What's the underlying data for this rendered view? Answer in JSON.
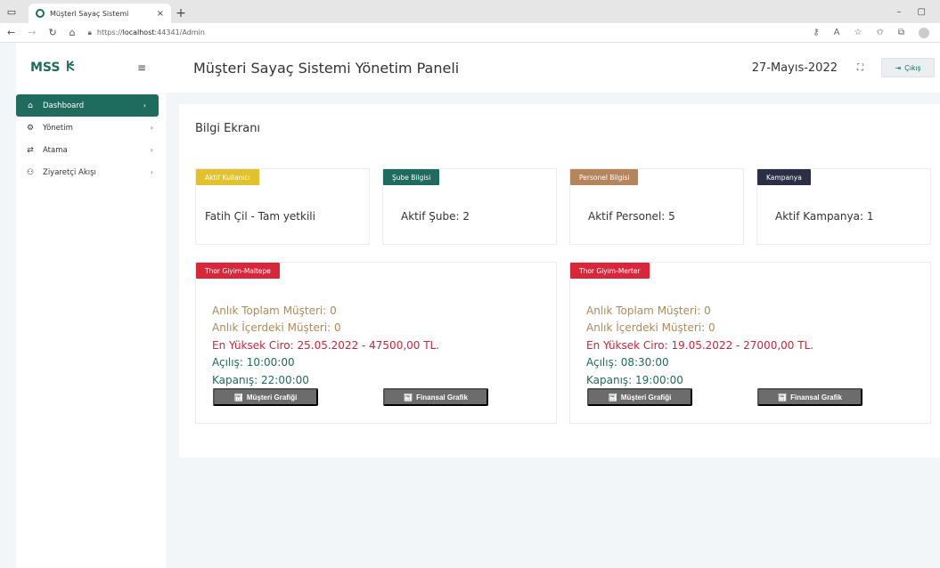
{
  "browser": {
    "tab_title": "Müşteri Sayaç Sistemi",
    "tab_close": "×",
    "new_tab": "+",
    "url_prefix": "https://",
    "url_host": "localhost",
    "url_rest": ":44341/Admin",
    "window_minimize": "–",
    "window_maximize": "▢"
  },
  "sidebar": {
    "brand": "MSS",
    "items": [
      {
        "label": "Dashboard",
        "icon": "home-icon",
        "active": true
      },
      {
        "label": "Yönetim",
        "icon": "gear-icon",
        "active": false
      },
      {
        "label": "Atama",
        "icon": "swap-icon",
        "active": false
      },
      {
        "label": "Ziyaretçi Akışı",
        "icon": "users-icon",
        "active": false
      }
    ]
  },
  "header": {
    "title": "Müşteri Sayaç Sistemi Yönetim Paneli",
    "date": "27-Mayıs-2022",
    "logout_label": "Çıkış"
  },
  "panel": {
    "title": "Bilgi Ekranı",
    "stats": [
      {
        "badge": "Aktif Kullanıcı",
        "value": "Fatih Çil - Tam yetkili",
        "color": "#e2c12e"
      },
      {
        "badge": "Şube Bilgisi",
        "value": "Aktif Şube: 2",
        "color": "#1f6b5e"
      },
      {
        "badge": "Personel Bilgisi",
        "value": "Aktif Personel: 5",
        "color": "#b5855e"
      },
      {
        "badge": "Kampanya",
        "value": "Aktif Kampanya: 1",
        "color": "#2a2f45"
      }
    ],
    "branches": [
      {
        "name": "Thor Giyim-Maltepe",
        "total": "Anlık Toplam Müşteri: 0",
        "inside": "Anlık İçerdeki Müşteri: 0",
        "top_revenue": "En Yüksek Ciro: 25.05.2022 - 47500,00 TL.",
        "open": "Açılış: 10:00:00",
        "close": "Kapanış: 22:00:00",
        "btn_customer": "Müşteri Grafiği",
        "btn_finance": "Finansal Grafik"
      },
      {
        "name": "Thor Giyim-Merter",
        "total": "Anlık Toplam Müşteri: 0",
        "inside": "Anlık İçerdeki Müşteri: 0",
        "top_revenue": "En Yüksek Ciro: 19.05.2022 - 27000,00 TL.",
        "open": "Açılış: 08:30:00",
        "close": "Kapanış: 19:00:00",
        "btn_customer": "Müşteri Grafiği",
        "btn_finance": "Finansal Grafik"
      }
    ]
  },
  "colors": {
    "primary": "#1f6b5e",
    "branch_badge": "#d9263a",
    "button": "#6c6c6c"
  }
}
